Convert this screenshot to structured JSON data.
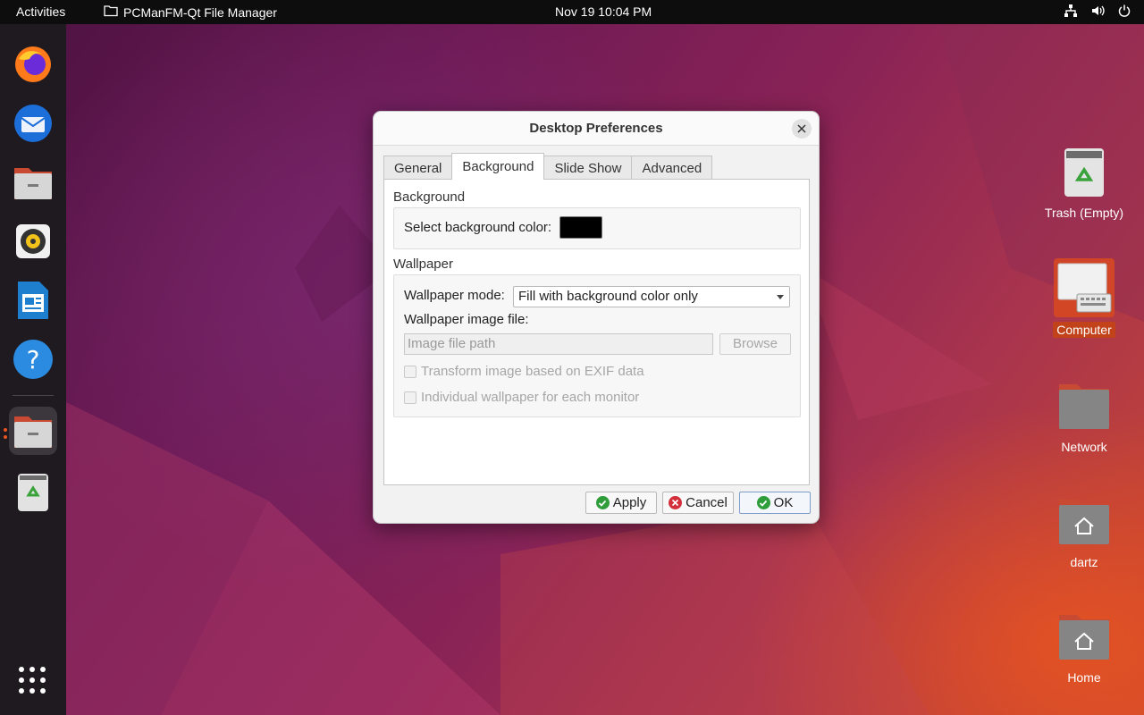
{
  "topbar": {
    "activities": "Activities",
    "app_name": "PCManFM-Qt File Manager",
    "clock": "Nov 19  10:04 PM",
    "tray_icons": [
      "network-icon",
      "volume-icon",
      "power-icon"
    ]
  },
  "dock": {
    "items": [
      "firefox-icon",
      "thunderbird-icon",
      "files-icon",
      "rhythmbox-icon",
      "libreoffice-writer-icon",
      "help-icon",
      "pcmanfm-icon",
      "trash-icon"
    ],
    "show_apps_icon": "apps-grid-icon"
  },
  "desktop": {
    "icons": [
      {
        "label": "Trash (Empty)",
        "icon": "trash-icon"
      },
      {
        "label": "Computer",
        "icon": "computer-icon"
      },
      {
        "label": "Network",
        "icon": "folder-icon"
      },
      {
        "label": "dartz",
        "icon": "home-folder-icon"
      },
      {
        "label": "Home",
        "icon": "home-folder-icon"
      }
    ]
  },
  "dialog": {
    "title": "Desktop Preferences",
    "tabs": [
      "General",
      "Background",
      "Slide Show",
      "Advanced"
    ],
    "active_tab": "Background",
    "background_group": {
      "title": "Background",
      "color_label": "Select background color:",
      "color_value": "#000000"
    },
    "wallpaper_group": {
      "title": "Wallpaper",
      "mode_label": "Wallpaper mode:",
      "mode_value": "Fill with background color only",
      "image_file_label": "Wallpaper image file:",
      "image_file_placeholder": "Image file path",
      "browse_label": "Browse",
      "exif_label": "Transform image based on EXIF data",
      "per_monitor_label": "Individual wallpaper for each monitor"
    },
    "buttons": {
      "apply": "Apply",
      "cancel": "Cancel",
      "ok": "OK"
    }
  },
  "colors": {
    "accent": "#e95420",
    "topbar": "#0d0d0d",
    "dock": "#1f1a1f"
  }
}
